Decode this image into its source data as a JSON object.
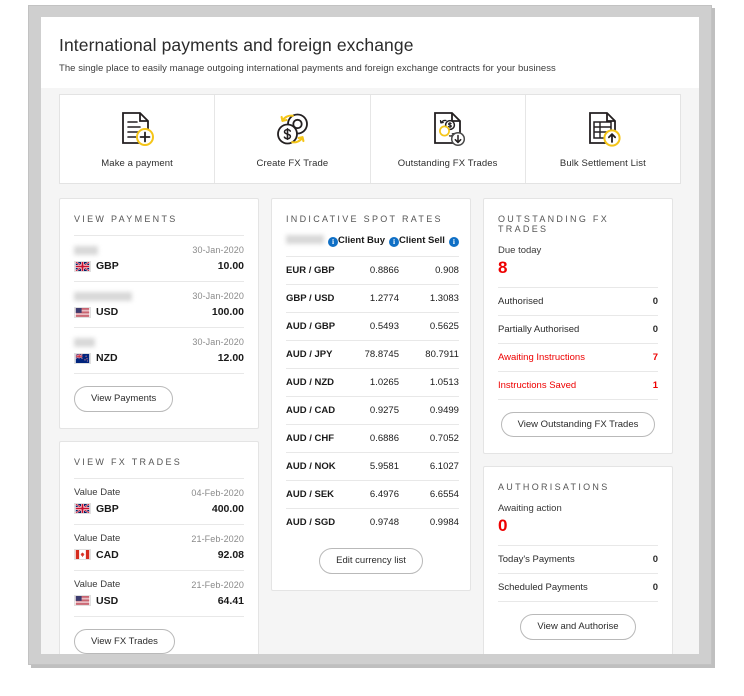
{
  "header": {
    "title": "International payments and foreign exchange",
    "subtitle": "The single place to easily manage outgoing international payments and foreign exchange contracts for your business"
  },
  "colors": {
    "accent_yellow": "#f5c518",
    "alert_red": "#ee0000",
    "info_blue": "#0f6fc5",
    "page_bg": "#f5f5f5",
    "card_bg": "#ffffff",
    "border": "#e4e4e4"
  },
  "actions": [
    {
      "label": "Make a payment",
      "icon": "document-plus-icon"
    },
    {
      "label": "Create FX Trade",
      "icon": "currency-exchange-icon"
    },
    {
      "label": "Outstanding FX Trades",
      "icon": "document-coins-down-icon"
    },
    {
      "label": "Bulk Settlement List",
      "icon": "document-table-up-icon"
    }
  ],
  "view_payments": {
    "title": "VIEW PAYMENTS",
    "rows": [
      {
        "payee": "",
        "redacted": true,
        "date": "30-Jan-2020",
        "currency": "GBP",
        "flag": "flag-gb",
        "amount": "10.00"
      },
      {
        "payee": "",
        "redacted": true,
        "date": "30-Jan-2020",
        "currency": "USD",
        "flag": "flag-us",
        "amount": "100.00"
      },
      {
        "payee": "",
        "redacted": true,
        "date": "30-Jan-2020",
        "currency": "NZD",
        "flag": "flag-nz",
        "amount": "12.00"
      }
    ],
    "button": "View Payments"
  },
  "view_fx_trades": {
    "title": "VIEW FX TRADES",
    "row_label": "Value Date",
    "rows": [
      {
        "label": "Value Date",
        "date": "04-Feb-2020",
        "currency": "GBP",
        "flag": "flag-gb",
        "amount": "400.00"
      },
      {
        "label": "Value Date",
        "date": "21-Feb-2020",
        "currency": "CAD",
        "flag": "flag-ca",
        "amount": "92.08"
      },
      {
        "label": "Value Date",
        "date": "21-Feb-2020",
        "currency": "USD",
        "flag": "flag-us",
        "amount": "64.41"
      }
    ],
    "button": "View FX Trades"
  },
  "spot_rates": {
    "title": "INDICATIVE SPOT RATES",
    "columns": {
      "pair": "",
      "pair_redacted": true,
      "buy": "Client Buy",
      "sell": "Client Sell",
      "info_icon": "info-icon"
    },
    "rows": [
      {
        "pair": "EUR / GBP",
        "buy": "0.8866",
        "sell": "0.908"
      },
      {
        "pair": "GBP / USD",
        "buy": "1.2774",
        "sell": "1.3083"
      },
      {
        "pair": "AUD / GBP",
        "buy": "0.5493",
        "sell": "0.5625"
      },
      {
        "pair": "AUD / JPY",
        "buy": "78.8745",
        "sell": "80.7911"
      },
      {
        "pair": "AUD / NZD",
        "buy": "1.0265",
        "sell": "1.0513"
      },
      {
        "pair": "AUD / CAD",
        "buy": "0.9275",
        "sell": "0.9499"
      },
      {
        "pair": "AUD / CHF",
        "buy": "0.6886",
        "sell": "0.7052"
      },
      {
        "pair": "AUD / NOK",
        "buy": "5.9581",
        "sell": "6.1027"
      },
      {
        "pair": "AUD / SEK",
        "buy": "6.4976",
        "sell": "6.6554"
      },
      {
        "pair": "AUD / SGD",
        "buy": "0.9748",
        "sell": "0.9984"
      }
    ],
    "button": "Edit currency list"
  },
  "outstanding_fx": {
    "title": "OUTSTANDING FX TRADES",
    "lead_label": "Due today",
    "lead_value": "8",
    "rows": [
      {
        "label": "Authorised",
        "value": "0",
        "alert": false
      },
      {
        "label": "Partially Authorised",
        "value": "0",
        "alert": false
      },
      {
        "label": "Awaiting Instructions",
        "value": "7",
        "alert": true
      },
      {
        "label": "Instructions Saved",
        "value": "1",
        "alert": true
      }
    ],
    "button": "View Outstanding FX Trades"
  },
  "authorisations": {
    "title": "AUTHORISATIONS",
    "lead_label": "Awaiting action",
    "lead_value": "0",
    "rows": [
      {
        "label": "Today's Payments",
        "value": "0",
        "alert": false
      },
      {
        "label": "Scheduled Payments",
        "value": "0",
        "alert": false
      }
    ],
    "button": "View and Authorise"
  }
}
